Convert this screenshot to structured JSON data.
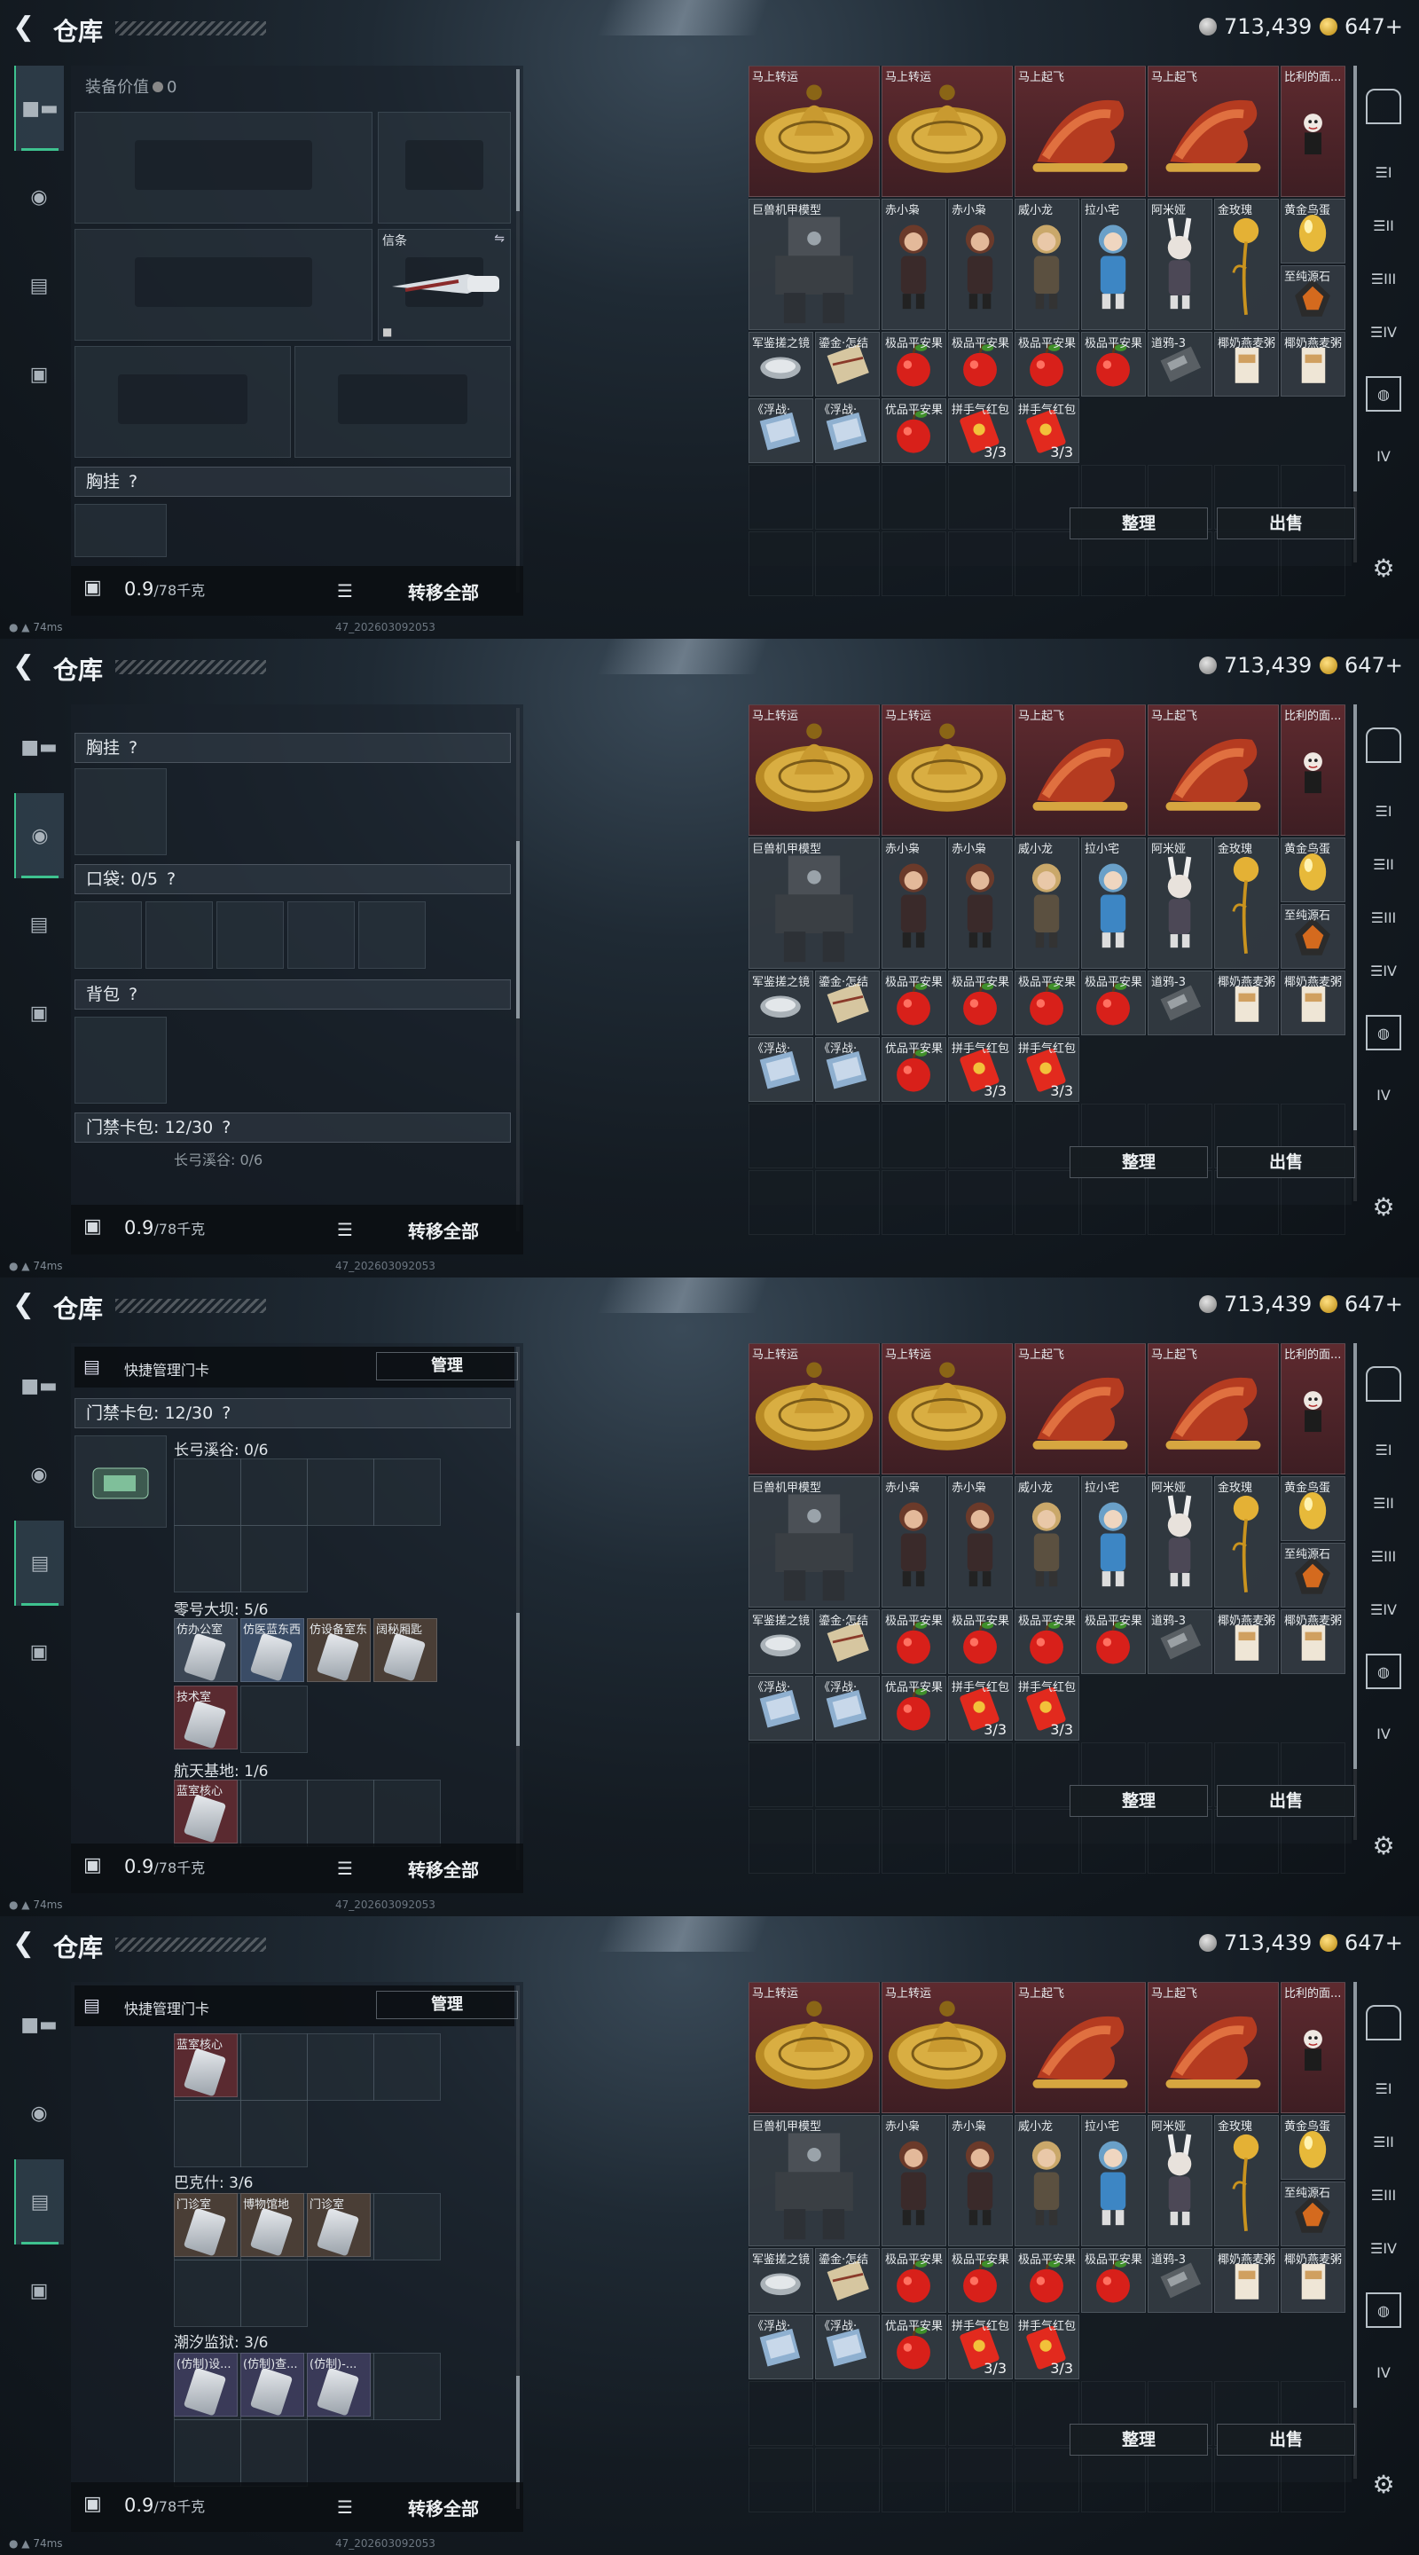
{
  "title": "仓库",
  "currency": {
    "silver": "713,439",
    "gold": "647+"
  },
  "equip_value_label": "装备价值",
  "equip_value": "0",
  "knife_label": "信条",
  "chest_label": "胸挂",
  "pocket_label": "口袋: 0/5",
  "backpack_label": "背包",
  "keycard_label": "门禁卡包: 12/30",
  "help_mark": "?",
  "weight": "0.9",
  "weight_max": "/78千克",
  "transfer_all": "转移全部",
  "manage_cards": "快捷管理门卡",
  "manage_btn": "管理",
  "sort_btn": "整理",
  "sell_btn": "出售",
  "ping": "74ms",
  "build": "47_202603092053",
  "zones": [
    {
      "label": "长弓溪谷: 0/6"
    },
    {
      "label": "零号大坝: 5/6"
    },
    {
      "label": "航天基地: 1/6"
    },
    {
      "label": "巴克什: 3/6"
    },
    {
      "label": "潮汐监狱: 3/6"
    }
  ],
  "dam_cards": [
    "仿办公室",
    "仿医蓝东西",
    "仿设备室东",
    "阔秘厢匙",
    "技术室"
  ],
  "space_cards": [
    "蓝室核心"
  ],
  "baksh_cards": [
    "门诊室",
    "博物馆地",
    "门诊室"
  ],
  "prison_cards": [
    "(仿制)设...",
    "(仿制)查...",
    "(仿制)-..."
  ],
  "stash_items": [
    {
      "name": "马上转运",
      "count": ""
    },
    {
      "name": "马上转运",
      "count": ""
    },
    {
      "name": "马上起飞",
      "count": ""
    },
    {
      "name": "马上起飞",
      "count": ""
    },
    {
      "name": "比利的面...",
      "count": ""
    },
    {
      "name": "巨兽机甲模型",
      "count": ""
    },
    {
      "name": "赤小枭",
      "count": ""
    },
    {
      "name": "赤小枭",
      "count": ""
    },
    {
      "name": "威小龙",
      "count": ""
    },
    {
      "name": "拉小宅",
      "count": ""
    },
    {
      "name": "阿米娅",
      "count": ""
    },
    {
      "name": "金玫瑰",
      "count": ""
    },
    {
      "name": "黄金鸟蛋",
      "count": ""
    },
    {
      "name": "至纯源石",
      "count": ""
    },
    {
      "name": "军鉴搓之镜",
      "count": ""
    },
    {
      "name": "鎏金·怎结",
      "count": ""
    },
    {
      "name": "极品平安果",
      "count": ""
    },
    {
      "name": "极品平安果",
      "count": ""
    },
    {
      "name": "极品平安果",
      "count": ""
    },
    {
      "name": "极品平安果",
      "count": ""
    },
    {
      "name": "道鸦-3",
      "count": ""
    },
    {
      "name": "椰奶燕麦粥",
      "count": ""
    },
    {
      "name": "椰奶燕麦粥",
      "count": ""
    },
    {
      "name": "《浮战·",
      "count": ""
    },
    {
      "name": "《浮战·",
      "count": ""
    },
    {
      "name": "优品平安果",
      "count": ""
    },
    {
      "name": "拼手气红包",
      "count": "3/3"
    },
    {
      "name": "拼手气红包",
      "count": "3/3"
    }
  ],
  "icons": {
    "back": "back-arrow-icon",
    "lock": "lock-icon",
    "list": "list-icon",
    "settings": "gear-icon"
  }
}
